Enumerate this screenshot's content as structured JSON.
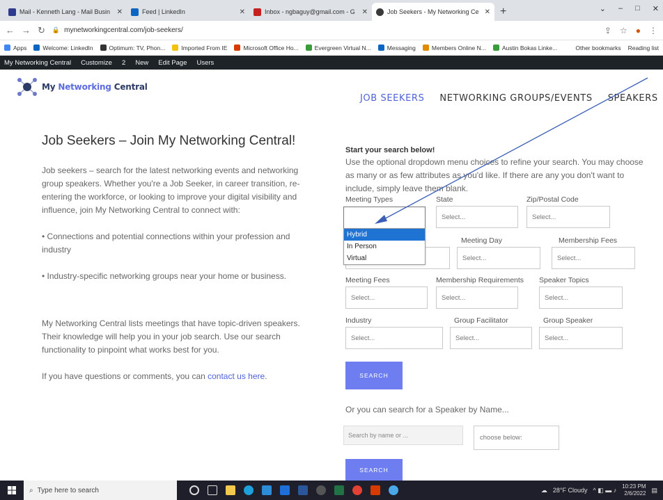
{
  "browser": {
    "tabs": [
      {
        "title": "Mail - Kenneth Lang - Mail Busin",
        "color": "#2f3b8f",
        "active": false
      },
      {
        "title": "Feed | LinkedIn",
        "color": "#0a66c2",
        "active": false
      },
      {
        "title": "Inbox - ngbaguy@gmail.com - G",
        "color": "#c5221f",
        "active": false
      },
      {
        "title": "Job Seekers - My Networking Ce",
        "color": "#3a3a3a",
        "active": true
      }
    ],
    "new_tab_label": "+",
    "address": "mynetworkingcentral.com/job-seekers/",
    "bookmarks": [
      {
        "label": "Apps",
        "color": "#4285f4"
      },
      {
        "label": "Welcome: LinkedIn",
        "color": "#0a66c2"
      },
      {
        "label": "Optimum: TV, Phon...",
        "color": "#333333"
      },
      {
        "label": "Imported From IE",
        "color": "#f4c20d"
      },
      {
        "label": "Microsoft Office Ho...",
        "color": "#d83b01"
      },
      {
        "label": "Evergreen Virtual N...",
        "color": "#3b9c3b"
      },
      {
        "label": "Messaging",
        "color": "#0a66c2"
      },
      {
        "label": "Members Online N...",
        "color": "#e08a00"
      },
      {
        "label": "Austin Bokas Linke...",
        "color": "#3b9c3b"
      }
    ],
    "bookmarks_right": [
      "Other bookmarks",
      "Reading list"
    ]
  },
  "wp_admin_bar": {
    "items": [
      "My Networking Central",
      "Customize",
      "2",
      "New",
      "Edit Page",
      "Users"
    ]
  },
  "site": {
    "logo_prefix": "My",
    "logo_highlight": "Networking",
    "logo_suffix": "Central",
    "nav": [
      {
        "label": "JOB SEEKERS",
        "active": true
      },
      {
        "label": "NETWORKING GROUPS/EVENTS",
        "active": false
      },
      {
        "label": "SPEAKERS",
        "active": false
      }
    ]
  },
  "left": {
    "heading": "Job Seekers – Join My Networking Central!",
    "p1": "Job seekers – search for the latest networking events and networking group speakers. Whether you're a Job Seeker, in career transition, re-entering the workforce, or looking to improve your digital visibility and influence, join My Networking Central to connect with:",
    "bullet1": "• Connections and potential connections within your profession and industry",
    "bullet2": "• Industry-specific networking groups near your home or business.",
    "p2": "My Networking Central lists meetings that have topic-driven speakers. Their knowledge will help you in your job search. Use our search functionality to pinpoint what works best for you.",
    "p3_prefix": "If you have questions or comments, you can ",
    "p3_link": "contact us here",
    "p3_suffix": "."
  },
  "search": {
    "intro_title": "Start your search below!",
    "intro": "Use the optional dropdown menu choices to refine your search. You may choose as many or as few attributes as you'd like. If there are any you don't want to include, simply leave them blank.",
    "row1": [
      {
        "label": "Meeting Types",
        "value": ""
      },
      {
        "label": "State",
        "value": "Select..."
      },
      {
        "label": "Zip/Postal Code",
        "value": "Select..."
      }
    ],
    "row2": [
      {
        "label": "",
        "value": ""
      },
      {
        "label": "Meeting Day",
        "value": "Select..."
      },
      {
        "label": "Membership Fees",
        "value": "Select..."
      }
    ],
    "row3": [
      {
        "label": "Meeting Fees",
        "value": "Select..."
      },
      {
        "label": "Membership Requirements",
        "value": "Select..."
      },
      {
        "label": "Speaker Topics",
        "value": "Select..."
      }
    ],
    "row4": [
      {
        "label": "Industry",
        "value": "Select..."
      },
      {
        "label": "Group Facilitator",
        "value": "Select..."
      },
      {
        "label": "Group Speaker",
        "value": "Select..."
      }
    ],
    "meeting_type_options": [
      "Hybrid",
      "In Person",
      "Virtual"
    ],
    "search_button": "SEARCH",
    "speaker_prompt": "Or you can search for a Speaker by Name...",
    "speaker_placeholder": "Search by name or ...",
    "speaker_choose": "choose below:",
    "speaker_search_button": "SEARCH"
  },
  "taskbar": {
    "search_placeholder": "Type here to search",
    "weather": "28°F Cloudy",
    "time": "10:23 PM",
    "date": "2/6/2022"
  }
}
